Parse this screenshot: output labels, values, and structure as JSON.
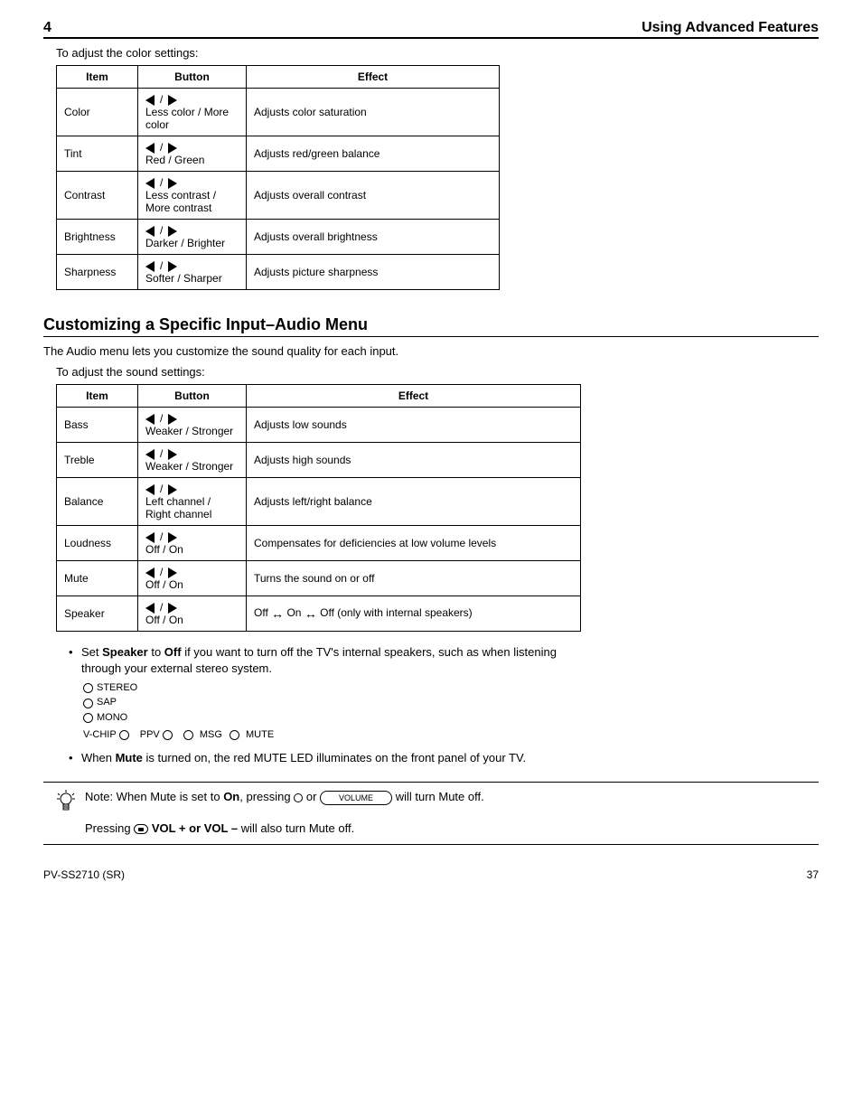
{
  "header": {
    "left": "4",
    "right": "Using Advanced Features"
  },
  "caption1": "To adjust the color settings:",
  "tableHeaders": {
    "item": "Item",
    "button": "Button",
    "effect": "Effect"
  },
  "table1": [
    {
      "item": "Color",
      "left": "Less color",
      "right": "More color",
      "effect": "Adjusts color saturation"
    },
    {
      "item": "Tint",
      "left": "Red",
      "right": "Green",
      "effect": "Adjusts red/green balance"
    },
    {
      "item": "Contrast",
      "left": "Less contrast",
      "right": "More contrast",
      "effect": "Adjusts overall contrast"
    },
    {
      "item": "Brightness",
      "left": "Darker",
      "right": "Brighter",
      "effect": "Adjusts overall brightness"
    },
    {
      "item": "Sharpness",
      "left": "Softer",
      "right": "Sharper",
      "effect": "Adjusts picture sharpness"
    }
  ],
  "section2": "Customizing a Specific Input–Audio Menu",
  "intro2_1": "The Audio menu lets you customize the sound quality for each input.",
  "intro2_2": "To adjust the sound settings:",
  "table2": [
    {
      "item": "Bass",
      "left": "Weaker",
      "right": "Stronger",
      "effect": "Adjusts low sounds"
    },
    {
      "item": "Treble",
      "left": "Weaker",
      "right": "Stronger",
      "effect": "Adjusts high sounds"
    },
    {
      "item": "Balance",
      "left": "Left channel",
      "right": "Right channel",
      "effect": "Adjusts left/right balance"
    },
    {
      "item": "Loudness",
      "left": "Off",
      "right": "On",
      "effect": "Compensates for deficiencies at low volume levels"
    },
    {
      "item": "Mute",
      "left": "Off",
      "right": "On",
      "effect": "Turns the sound on or off"
    },
    {
      "item": "Speaker",
      "left": "Off",
      "right": "On",
      "effect": "Off    On    Off (only with internal speakers)"
    }
  ],
  "speaker": {
    "p1a": "Set ",
    "p1b": "Speaker",
    "p1c": " to ",
    "p1d": "Off",
    "p1e": " if you want to turn off the TV's internal speakers, such as when listening",
    "p2": "through your external stereo system.",
    "leds": {
      "r1": "STEREO",
      "r2": "SAP",
      "r3": "MONO",
      "b1": "V-CHIP",
      "b2": "PPV",
      "b3": "MSG",
      "b4": "MUTE"
    },
    "p3a": "When ",
    "p3b": "Mute",
    "p3c": " is turned on, the red MUTE LED illuminates on the front panel of your TV."
  },
  "note": {
    "l1a": "Note: When Mute is set to ",
    "l1b": "On",
    "l1c": ", pressing",
    "l1d": "or",
    "l1e": "VOLUME",
    "l1f": " will turn Mute off.",
    "l2a": "Pressing",
    "l2b": "VOL + or VOL –",
    "l2c": " will also turn Mute off."
  },
  "footer": {
    "left": "PV-SS2710 (SR)",
    "right": "37"
  }
}
